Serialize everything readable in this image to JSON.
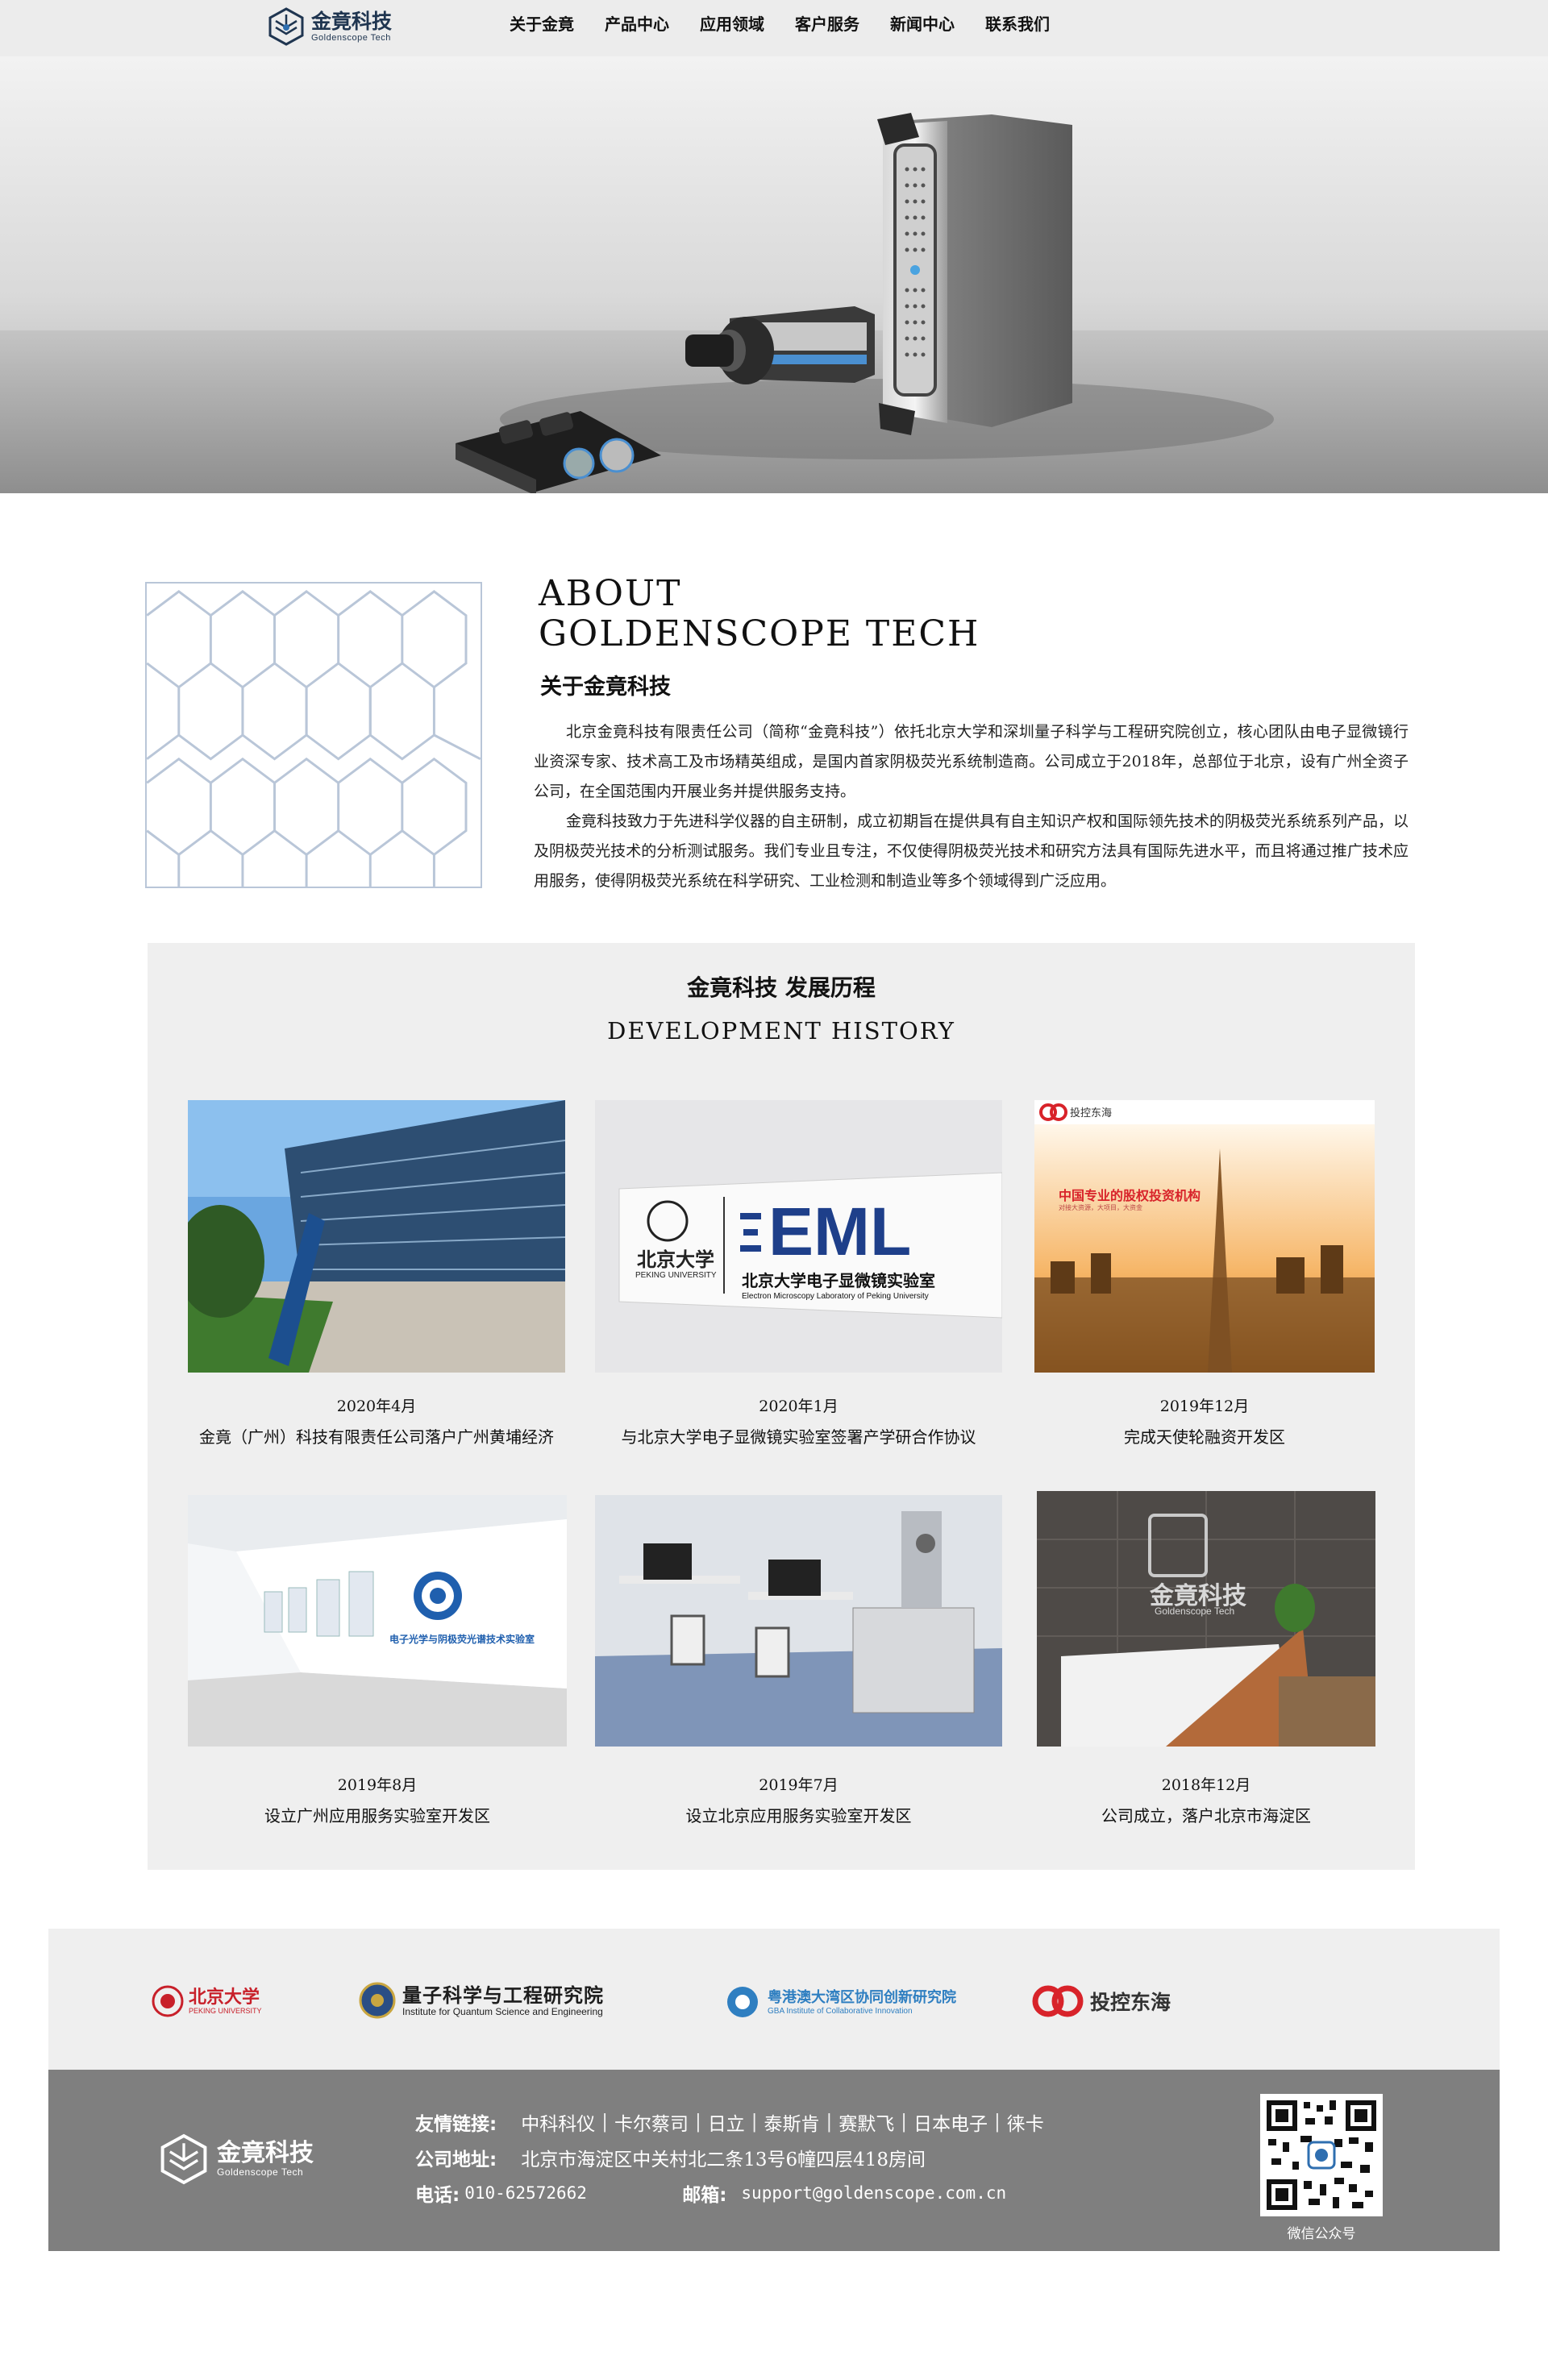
{
  "nav": {
    "logo": {
      "cn": "金竟科技",
      "en": "Goldenscope Tech"
    },
    "items": [
      "关于金竟",
      "产品中心",
      "应用领域",
      "客户服务",
      "新闻中心",
      "联系我们"
    ]
  },
  "about": {
    "title_en_line1": "ABOUT",
    "title_en_line2": "GOLDENSCOPE TECH",
    "title_cn": "关于金竟科技",
    "para1": "北京金竟科技有限责任公司（简称“金竟科技”）依托北京大学和深圳量子科学与工程研究院创立，核心团队由电子显微镜行业资深专家、技术高工及市场精英组成，是国内首家阴极荧光系统制造商。公司成立于2018年，总部位于北京，设有广州全资子公司，在全国范围内开展业务并提供服务支持。",
    "para2": "金竟科技致力于先进科学仪器的自主研制，成立初期旨在提供具有自主知识产权和国际领先技术的阴极荧光系统系列产品，以及阴极荧光技术的分析测试服务。我们专业且专注，不仅使得阴极荧光技术和研究方法具有国际先进水平，而且将通过推广技术应用服务，使得阴极荧光系统在科学研究、工业检测和制造业等多个领域得到广泛应用。"
  },
  "history": {
    "title_cn": "金竟科技  发展历程",
    "title_en": "DEVELOPMENT HISTORY",
    "events": [
      {
        "date": "2020年4月",
        "desc": "金竟（广州）科技有限责任公司落户广州黄埔经济"
      },
      {
        "date": "2020年1月",
        "desc": "与北京大学电子显微镜实验室签署产学研合作协议"
      },
      {
        "date": "2019年12月",
        "desc": "完成天使轮融资开发区"
      },
      {
        "date": "2019年8月",
        "desc": "设立广州应用服务实验室开发区"
      },
      {
        "date": "2019年7月",
        "desc": "设立北京应用服务实验室开发区"
      },
      {
        "date": "2018年12月",
        "desc": "公司成立，落户北京市海淀区"
      }
    ],
    "image_text": {
      "eml_logo": "EML",
      "eml_cn": "北京大学电子显微镜实验室",
      "eml_en": "Electron Microscopy Laboratory of Peking University",
      "pku_cn": "北京大学",
      "pku_en": "PEKING UNIVERSITY",
      "invest_brand": "投控东海",
      "invest_slogan": "中国专业的股权投资机构",
      "invest_sub": "对接大资源，大项目，大资金",
      "lab_sign": "电子光学与阴极荧光谱技术实验室",
      "office_logo_cn": "金竟科技",
      "office_logo_en": "Goldenscope Tech"
    }
  },
  "partners": [
    {
      "cn": "北京大学",
      "en": "PEKING UNIVERSITY"
    },
    {
      "cn": "量子科学与工程研究院",
      "en": "Institute for Quantum Science and Engineering"
    },
    {
      "cn": "粤港澳大湾区协同创新研究院",
      "en": "GBA Institute of Collaborative Innovation"
    },
    {
      "cn": "投控东海",
      "en": ""
    }
  ],
  "footer": {
    "logo": {
      "cn": "金竟科技",
      "en": "Goldenscope Tech"
    },
    "links_label": "友情链接:",
    "links": [
      "中科科仪",
      "卡尔蔡司",
      "日立",
      "泰斯肯",
      "赛默飞",
      "日本电子",
      "徕卡"
    ],
    "address_label": "公司地址:",
    "address": "北京市海淀区中关村北二条13号6幢四层418房间",
    "phone_label": "电话:",
    "phone": "010-62572662",
    "email_label": "邮箱:",
    "email": "support@goldenscope.com.cn",
    "qr_caption": "微信公众号"
  },
  "colors": {
    "brand": "#1f3550",
    "footer_bg": "#7f7f7f",
    "panel_bg": "#efefef",
    "accent_red": "#c8202a"
  }
}
